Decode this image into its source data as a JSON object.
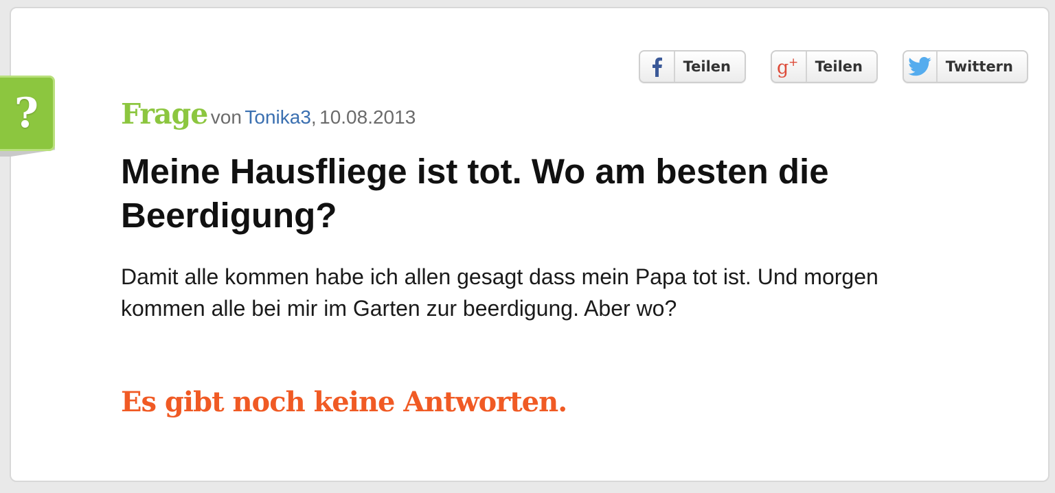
{
  "share": {
    "facebook": {
      "label": "Teilen",
      "icon": "facebook-icon",
      "color": "#3b5998"
    },
    "googleplus": {
      "label": "Teilen",
      "icon": "google-plus-icon",
      "color": "#dd4b39"
    },
    "twitter": {
      "label": "Twittern",
      "icon": "twitter-icon",
      "color": "#55acee"
    }
  },
  "question": {
    "tab_icon": "question-mark-icon",
    "tab_symbol": "?",
    "kind": "Frage",
    "by": "von",
    "author": "Tonika3",
    "separator": ",",
    "date": "10.08.2013",
    "title": "Meine Hausfliege ist tot. Wo am besten die Beerdigung?",
    "body": "Damit alle kommen habe ich allen gesagt dass mein Papa tot ist. Und morgen kommen alle bei mir im Garten zur beerdigung. Aber wo?"
  },
  "answers": {
    "empty_message": "Es gibt noch keine Antworten."
  },
  "colors": {
    "accent_green": "#8cc63f",
    "accent_orange": "#f05a24",
    "link_blue": "#3a6fb0"
  }
}
